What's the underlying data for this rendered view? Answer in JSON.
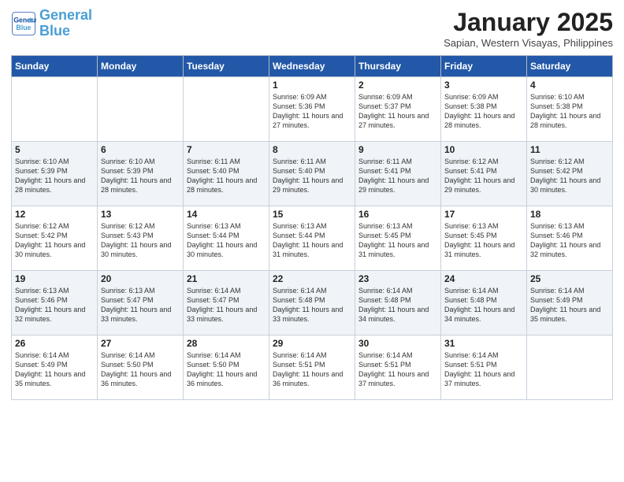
{
  "header": {
    "logo_line1": "General",
    "logo_line2": "Blue",
    "month": "January 2025",
    "location": "Sapian, Western Visayas, Philippines"
  },
  "weekdays": [
    "Sunday",
    "Monday",
    "Tuesday",
    "Wednesday",
    "Thursday",
    "Friday",
    "Saturday"
  ],
  "weeks": [
    [
      {
        "day": "",
        "info": ""
      },
      {
        "day": "",
        "info": ""
      },
      {
        "day": "",
        "info": ""
      },
      {
        "day": "1",
        "info": "Sunrise: 6:09 AM\nSunset: 5:36 PM\nDaylight: 11 hours and 27 minutes."
      },
      {
        "day": "2",
        "info": "Sunrise: 6:09 AM\nSunset: 5:37 PM\nDaylight: 11 hours and 27 minutes."
      },
      {
        "day": "3",
        "info": "Sunrise: 6:09 AM\nSunset: 5:38 PM\nDaylight: 11 hours and 28 minutes."
      },
      {
        "day": "4",
        "info": "Sunrise: 6:10 AM\nSunset: 5:38 PM\nDaylight: 11 hours and 28 minutes."
      }
    ],
    [
      {
        "day": "5",
        "info": "Sunrise: 6:10 AM\nSunset: 5:39 PM\nDaylight: 11 hours and 28 minutes."
      },
      {
        "day": "6",
        "info": "Sunrise: 6:10 AM\nSunset: 5:39 PM\nDaylight: 11 hours and 28 minutes."
      },
      {
        "day": "7",
        "info": "Sunrise: 6:11 AM\nSunset: 5:40 PM\nDaylight: 11 hours and 28 minutes."
      },
      {
        "day": "8",
        "info": "Sunrise: 6:11 AM\nSunset: 5:40 PM\nDaylight: 11 hours and 29 minutes."
      },
      {
        "day": "9",
        "info": "Sunrise: 6:11 AM\nSunset: 5:41 PM\nDaylight: 11 hours and 29 minutes."
      },
      {
        "day": "10",
        "info": "Sunrise: 6:12 AM\nSunset: 5:41 PM\nDaylight: 11 hours and 29 minutes."
      },
      {
        "day": "11",
        "info": "Sunrise: 6:12 AM\nSunset: 5:42 PM\nDaylight: 11 hours and 30 minutes."
      }
    ],
    [
      {
        "day": "12",
        "info": "Sunrise: 6:12 AM\nSunset: 5:42 PM\nDaylight: 11 hours and 30 minutes."
      },
      {
        "day": "13",
        "info": "Sunrise: 6:12 AM\nSunset: 5:43 PM\nDaylight: 11 hours and 30 minutes."
      },
      {
        "day": "14",
        "info": "Sunrise: 6:13 AM\nSunset: 5:44 PM\nDaylight: 11 hours and 30 minutes."
      },
      {
        "day": "15",
        "info": "Sunrise: 6:13 AM\nSunset: 5:44 PM\nDaylight: 11 hours and 31 minutes."
      },
      {
        "day": "16",
        "info": "Sunrise: 6:13 AM\nSunset: 5:45 PM\nDaylight: 11 hours and 31 minutes."
      },
      {
        "day": "17",
        "info": "Sunrise: 6:13 AM\nSunset: 5:45 PM\nDaylight: 11 hours and 31 minutes."
      },
      {
        "day": "18",
        "info": "Sunrise: 6:13 AM\nSunset: 5:46 PM\nDaylight: 11 hours and 32 minutes."
      }
    ],
    [
      {
        "day": "19",
        "info": "Sunrise: 6:13 AM\nSunset: 5:46 PM\nDaylight: 11 hours and 32 minutes."
      },
      {
        "day": "20",
        "info": "Sunrise: 6:13 AM\nSunset: 5:47 PM\nDaylight: 11 hours and 33 minutes."
      },
      {
        "day": "21",
        "info": "Sunrise: 6:14 AM\nSunset: 5:47 PM\nDaylight: 11 hours and 33 minutes."
      },
      {
        "day": "22",
        "info": "Sunrise: 6:14 AM\nSunset: 5:48 PM\nDaylight: 11 hours and 33 minutes."
      },
      {
        "day": "23",
        "info": "Sunrise: 6:14 AM\nSunset: 5:48 PM\nDaylight: 11 hours and 34 minutes."
      },
      {
        "day": "24",
        "info": "Sunrise: 6:14 AM\nSunset: 5:48 PM\nDaylight: 11 hours and 34 minutes."
      },
      {
        "day": "25",
        "info": "Sunrise: 6:14 AM\nSunset: 5:49 PM\nDaylight: 11 hours and 35 minutes."
      }
    ],
    [
      {
        "day": "26",
        "info": "Sunrise: 6:14 AM\nSunset: 5:49 PM\nDaylight: 11 hours and 35 minutes."
      },
      {
        "day": "27",
        "info": "Sunrise: 6:14 AM\nSunset: 5:50 PM\nDaylight: 11 hours and 36 minutes."
      },
      {
        "day": "28",
        "info": "Sunrise: 6:14 AM\nSunset: 5:50 PM\nDaylight: 11 hours and 36 minutes."
      },
      {
        "day": "29",
        "info": "Sunrise: 6:14 AM\nSunset: 5:51 PM\nDaylight: 11 hours and 36 minutes."
      },
      {
        "day": "30",
        "info": "Sunrise: 6:14 AM\nSunset: 5:51 PM\nDaylight: 11 hours and 37 minutes."
      },
      {
        "day": "31",
        "info": "Sunrise: 6:14 AM\nSunset: 5:51 PM\nDaylight: 11 hours and 37 minutes."
      },
      {
        "day": "",
        "info": ""
      }
    ]
  ]
}
